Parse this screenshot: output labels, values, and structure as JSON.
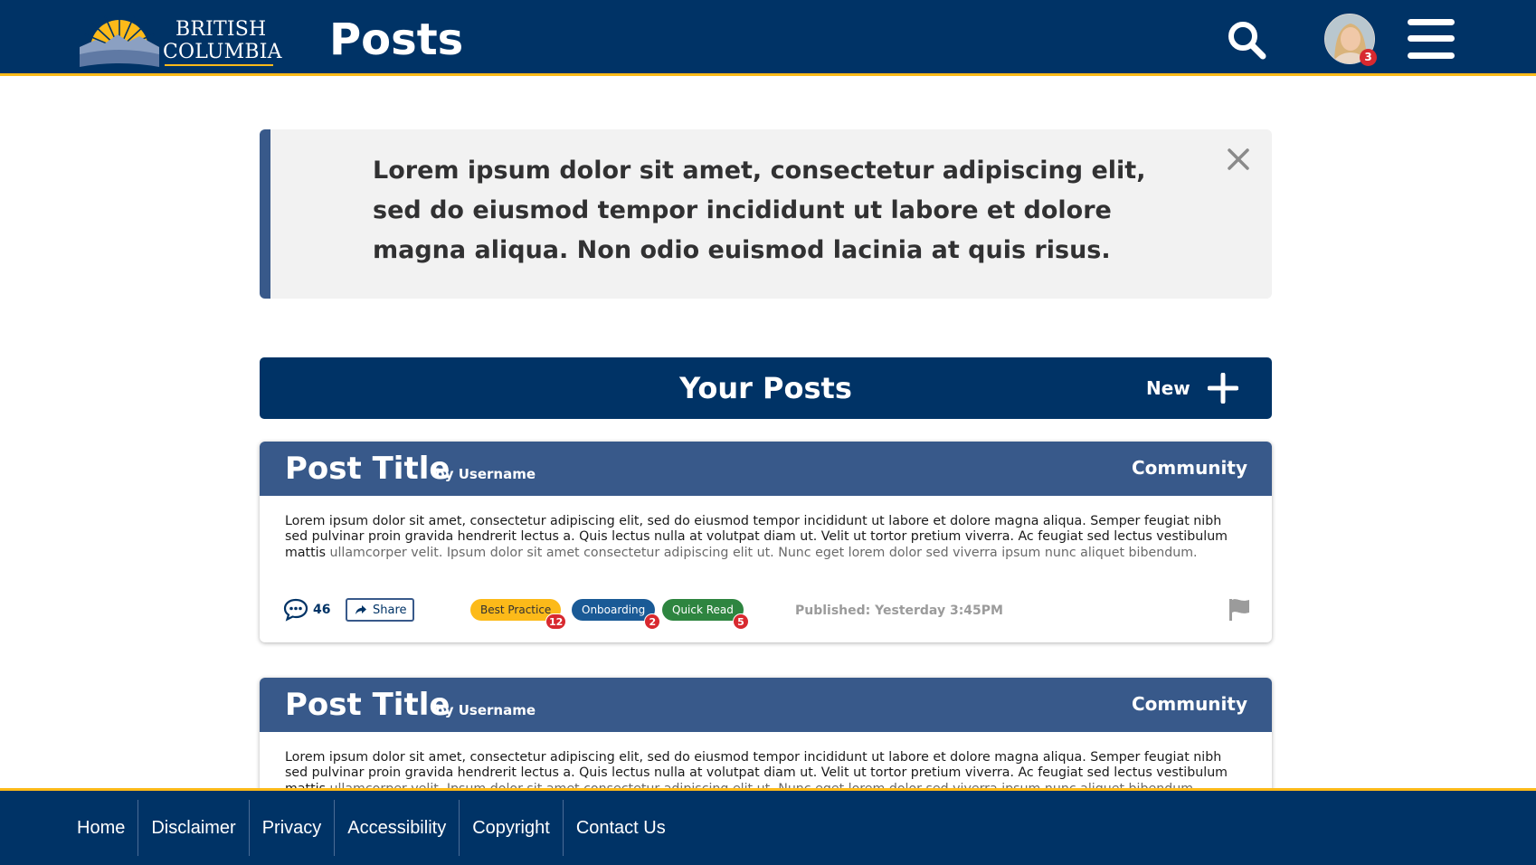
{
  "header": {
    "logo_line1": "British",
    "logo_line2": "Columbia",
    "title": "Posts",
    "search_icon": "search-icon",
    "notification_count": "3",
    "menu_icon": "hamburger-menu-icon"
  },
  "alert": {
    "text": "Lorem ipsum dolor sit amet, consectetur adipiscing elit, sed do eiusmod tempor incididunt ut labore et dolore magna aliqua. Non odio euismod lacinia at quis risus.",
    "close_icon": "close-icon"
  },
  "posts_bar": {
    "title": "Your Posts",
    "new_label": "New"
  },
  "posts": [
    {
      "title": "Post Title",
      "by": "by Username",
      "category": "Community",
      "body_main": "Lorem ipsum dolor sit amet, consectetur adipiscing elit, sed do eiusmod tempor incididunt ut labore et dolore magna aliqua. Semper feugiat nibh sed pulvinar proin gravida hendrerit lectus a. Quis lectus nulla at volutpat diam ut. Velit ut tortor pretium viverra. Ac feugiat sed lectus vestibulum mattis ",
      "body_fade": "ullamcorper velit. Ipsum dolor sit amet consectetur adipiscing elit ut. Nunc eget lorem dolor sed viverra ipsum nunc aliquet bibendum.",
      "comment_count": "46",
      "share_label": "Share",
      "tags": [
        {
          "label": "Best Practice",
          "count": "12"
        },
        {
          "label": "Onboarding",
          "count": "2"
        },
        {
          "label": "Quick Read",
          "count": "5"
        }
      ],
      "published": "Published: Yesterday 3:45PM"
    },
    {
      "title": "Post Title",
      "by": "by Username",
      "category": "Community",
      "body_main": "Lorem ipsum dolor sit amet, consectetur adipiscing elit, sed do eiusmod tempor incididunt ut labore et dolore magna aliqua. Semper feugiat nibh sed pulvinar proin gravida hendrerit lectus a. Quis lectus nulla at volutpat diam ut. Velit ut tortor pretium viverra. Ac feugiat sed lectus vestibulum mattis ",
      "body_fade": "ullamcorper velit. Ipsum dolor sit amet consectetur adipiscing elit ut. Nunc eget lorem dolor sed viverra ipsum nunc aliquet bibendum."
    }
  ],
  "footer": {
    "links": [
      "Home",
      "Disclaimer",
      "Privacy",
      "Accessibility",
      "Copyright",
      "Contact Us"
    ]
  },
  "colors": {
    "primary": "#003366",
    "secondary": "#38598a",
    "gold": "#fcba19",
    "badge_red": "#d8292f",
    "tag_best_practice": "#fcba19",
    "tag_onboarding": "#1a5a96",
    "tag_quick_read": "#2e8540"
  }
}
